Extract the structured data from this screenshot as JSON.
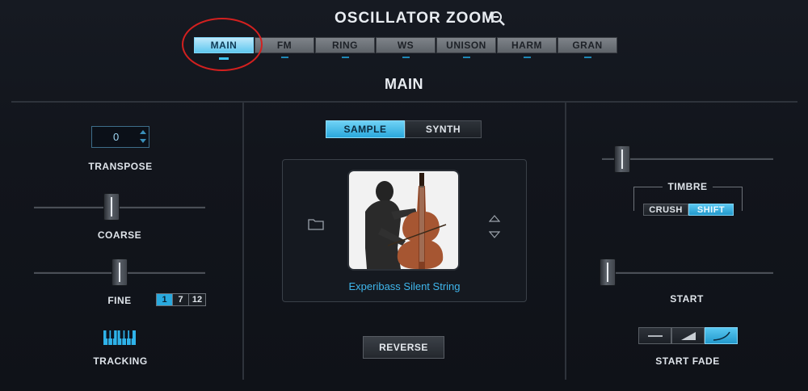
{
  "header": {
    "title": "OSCILLATOR ZOOM",
    "zoom_icon": "zoom-out-icon"
  },
  "tabs": [
    {
      "label": "MAIN",
      "active": true
    },
    {
      "label": "FM",
      "active": false
    },
    {
      "label": "RING",
      "active": false
    },
    {
      "label": "WS",
      "active": false
    },
    {
      "label": "UNISON",
      "active": false
    },
    {
      "label": "HARM",
      "active": false
    },
    {
      "label": "GRAN",
      "active": false
    }
  ],
  "section": {
    "title": "MAIN"
  },
  "left": {
    "transpose": {
      "value": "0",
      "label": "TRANSPOSE"
    },
    "coarse": {
      "label": "COARSE"
    },
    "fine": {
      "label": "FINE",
      "steps": [
        "1",
        "7",
        "12"
      ],
      "selected": "1"
    },
    "tracking": {
      "label": "TRACKING",
      "icon": "piano-keys-icon"
    }
  },
  "center": {
    "mode": {
      "options": [
        "SAMPLE",
        "SYNTH"
      ],
      "selected": "SAMPLE"
    },
    "sample_name": "Experibass Silent String",
    "reverse_label": "REVERSE"
  },
  "right": {
    "timbre": {
      "label": "TIMBRE",
      "options": [
        "CRUSH",
        "SHIFT"
      ],
      "selected": "SHIFT"
    },
    "start": {
      "label": "START"
    },
    "start_fade": {
      "label": "START FADE",
      "options": [
        "flat-fade-icon",
        "linear-fade-icon",
        "curved-fade-icon"
      ],
      "selected": "curved-fade-icon"
    }
  },
  "colors": {
    "accent": "#3fb6ec",
    "annotation": "#d2201f"
  }
}
